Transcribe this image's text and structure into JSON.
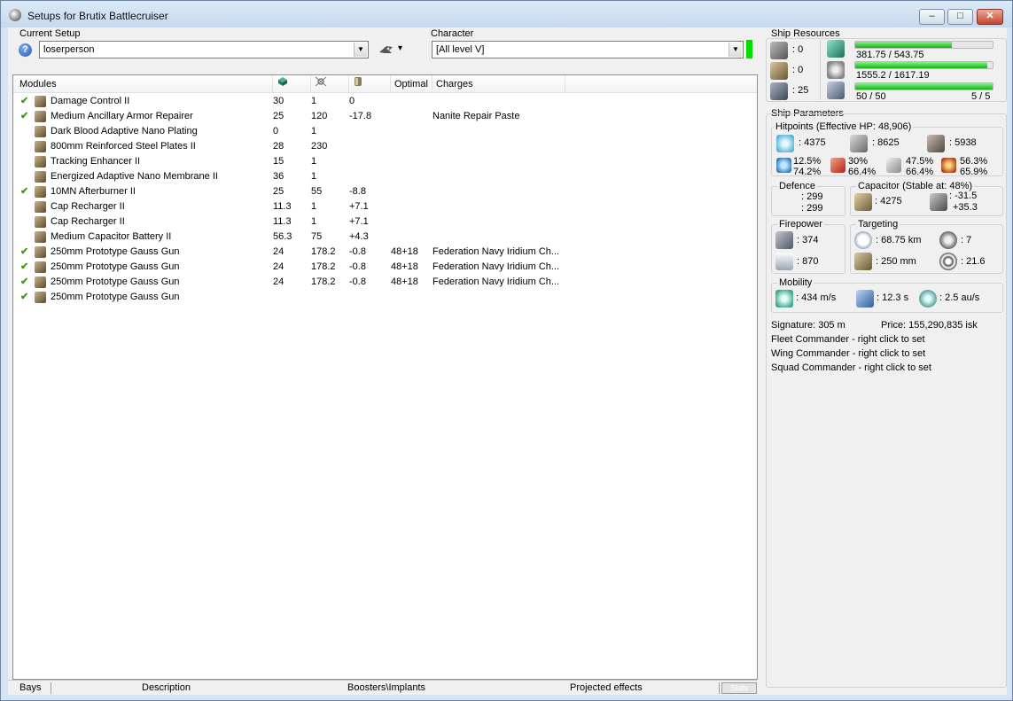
{
  "window": {
    "title": "Setups for Brutix Battlecruiser",
    "controls": {
      "minimize": "–",
      "maximize": "□",
      "close": "✕"
    }
  },
  "setup": {
    "current_setup_label": "Current Setup",
    "current_setup_value": "loserperson",
    "character_label": "Character",
    "character_value": "[All level V]",
    "tool_dropdown": "▾"
  },
  "modules_table": {
    "headers": [
      "Modules",
      "",
      "",
      "",
      "Optimal",
      "Charges"
    ],
    "header_icons": [
      "cpu-icon",
      "powergrid-icon",
      "capacitor-icon"
    ],
    "rows": [
      {
        "checked": true,
        "name": "Damage Control II",
        "cpu": "30",
        "pg": "1",
        "cap": "0",
        "optimal": "",
        "charges": "",
        "icon": "damage-control-icon"
      },
      {
        "checked": true,
        "name": "Medium Ancillary Armor Repairer",
        "cpu": "25",
        "pg": "120",
        "cap": "-17.8",
        "optimal": "",
        "charges": "Nanite Repair Paste",
        "icon": "armor-repairer-icon"
      },
      {
        "checked": false,
        "name": "Dark Blood Adaptive Nano Plating",
        "cpu": "0",
        "pg": "1",
        "cap": "",
        "optimal": "",
        "charges": "",
        "icon": "nano-plating-icon"
      },
      {
        "checked": false,
        "name": "800mm Reinforced Steel Plates II",
        "cpu": "28",
        "pg": "230",
        "cap": "",
        "optimal": "",
        "charges": "",
        "icon": "armor-plate-icon"
      },
      {
        "checked": false,
        "name": "Tracking Enhancer II",
        "cpu": "15",
        "pg": "1",
        "cap": "",
        "optimal": "",
        "charges": "",
        "icon": "tracking-enhancer-icon"
      },
      {
        "checked": false,
        "name": "Energized Adaptive Nano Membrane II",
        "cpu": "36",
        "pg": "1",
        "cap": "",
        "optimal": "",
        "charges": "",
        "icon": "nano-membrane-icon"
      },
      {
        "checked": true,
        "name": "10MN Afterburner II",
        "cpu": "25",
        "pg": "55",
        "cap": "-8.8",
        "optimal": "",
        "charges": "",
        "icon": "afterburner-icon"
      },
      {
        "checked": false,
        "name": "Cap Recharger II",
        "cpu": "11.3",
        "pg": "1",
        "cap": "+7.1",
        "optimal": "",
        "charges": "",
        "icon": "cap-recharger-icon"
      },
      {
        "checked": false,
        "name": "Cap Recharger II",
        "cpu": "11.3",
        "pg": "1",
        "cap": "+7.1",
        "optimal": "",
        "charges": "",
        "icon": "cap-recharger-icon"
      },
      {
        "checked": false,
        "name": "Medium Capacitor Battery II",
        "cpu": "56.3",
        "pg": "75",
        "cap": "+4.3",
        "optimal": "",
        "charges": "",
        "icon": "capacitor-battery-icon"
      },
      {
        "checked": true,
        "name": "250mm Prototype Gauss Gun",
        "cpu": "24",
        "pg": "178.2",
        "cap": "-0.8",
        "optimal": "48+18",
        "charges": "Federation Navy Iridium Ch...",
        "icon": "hybrid-turret-icon"
      },
      {
        "checked": true,
        "name": "250mm Prototype Gauss Gun",
        "cpu": "24",
        "pg": "178.2",
        "cap": "-0.8",
        "optimal": "48+18",
        "charges": "Federation Navy Iridium Ch...",
        "icon": "hybrid-turret-icon"
      },
      {
        "checked": true,
        "name": "250mm Prototype Gauss Gun",
        "cpu": "24",
        "pg": "178.2",
        "cap": "-0.8",
        "optimal": "48+18",
        "charges": "Federation Navy Iridium Ch...",
        "icon": "hybrid-turret-icon"
      },
      {
        "checked": true,
        "name": "250mm Prototype Gauss Gun",
        "cpu": "",
        "pg": "",
        "cap": "",
        "optimal": "",
        "charges": "",
        "icon": "hybrid-turret-icon"
      }
    ]
  },
  "bottom_tabs": {
    "bays": "Bays",
    "description": "Description",
    "boosters": "Boosters\\Implants",
    "projected": "Projected effects",
    "stats": "Stats"
  },
  "resources": {
    "title": "Ship Resources",
    "turret_slots": ": 0",
    "launcher_slots": ": 0",
    "calibration": ": 25",
    "cpu": {
      "text": "381.75 / 543.75",
      "fraction": 0.702
    },
    "powergrid": {
      "text": "1555.2 / 1617.19",
      "fraction": 0.962
    },
    "drones": {
      "text": "50 / 50",
      "fraction": 1.0,
      "count": "5 / 5"
    }
  },
  "parameters": {
    "title": "Ship Parameters",
    "hitpoints_title": "Hitpoints (Effective HP: 48,906)",
    "shield_hp": ": 4375",
    "armor_hp": ": 8625",
    "structure_hp": ": 5938",
    "resists": [
      {
        "top": "12.5%",
        "bottom": "74.2%",
        "icon": "em-resist-icon"
      },
      {
        "top": "30%",
        "bottom": "66.4%",
        "icon": "thermal-resist-icon"
      },
      {
        "top": "47.5%",
        "bottom": "66.4%",
        "icon": "kinetic-resist-icon"
      },
      {
        "top": "56.3%",
        "bottom": "65.9%",
        "icon": "explosive-resist-icon"
      }
    ],
    "defence_title": "Defence",
    "defence_top": ": 299",
    "defence_bottom": ": 299",
    "capacitor_title": "Capacitor (Stable at: 48%)",
    "capacitor_amount": ": 4275",
    "capacitor_top": ": -31.5",
    "capacitor_bottom": "+35.3",
    "firepower_title": "Firepower",
    "firepower_dps": ": 374",
    "firepower_volley": ": 870",
    "targeting_title": "Targeting",
    "targeting_range": ": 68.75 km",
    "targeting_targets": ": 7",
    "targeting_resolution": ": 250 mm",
    "targeting_sensor": ": 21.6",
    "mobility_title": "Mobility",
    "velocity": ": 434 m/s",
    "align_time": ": 12.3 s",
    "warp_speed": ": 2.5 au/s",
    "signature": "Signature: 305 m",
    "price": "Price: 155,290,835 isk",
    "fleet_commander": "Fleet Commander - right click to set",
    "wing_commander": "Wing Commander - right click to set",
    "squad_commander": "Squad Commander - right click to set"
  },
  "colors": {
    "accent_green": "#00dd00",
    "check_green": "#3a9a14"
  }
}
